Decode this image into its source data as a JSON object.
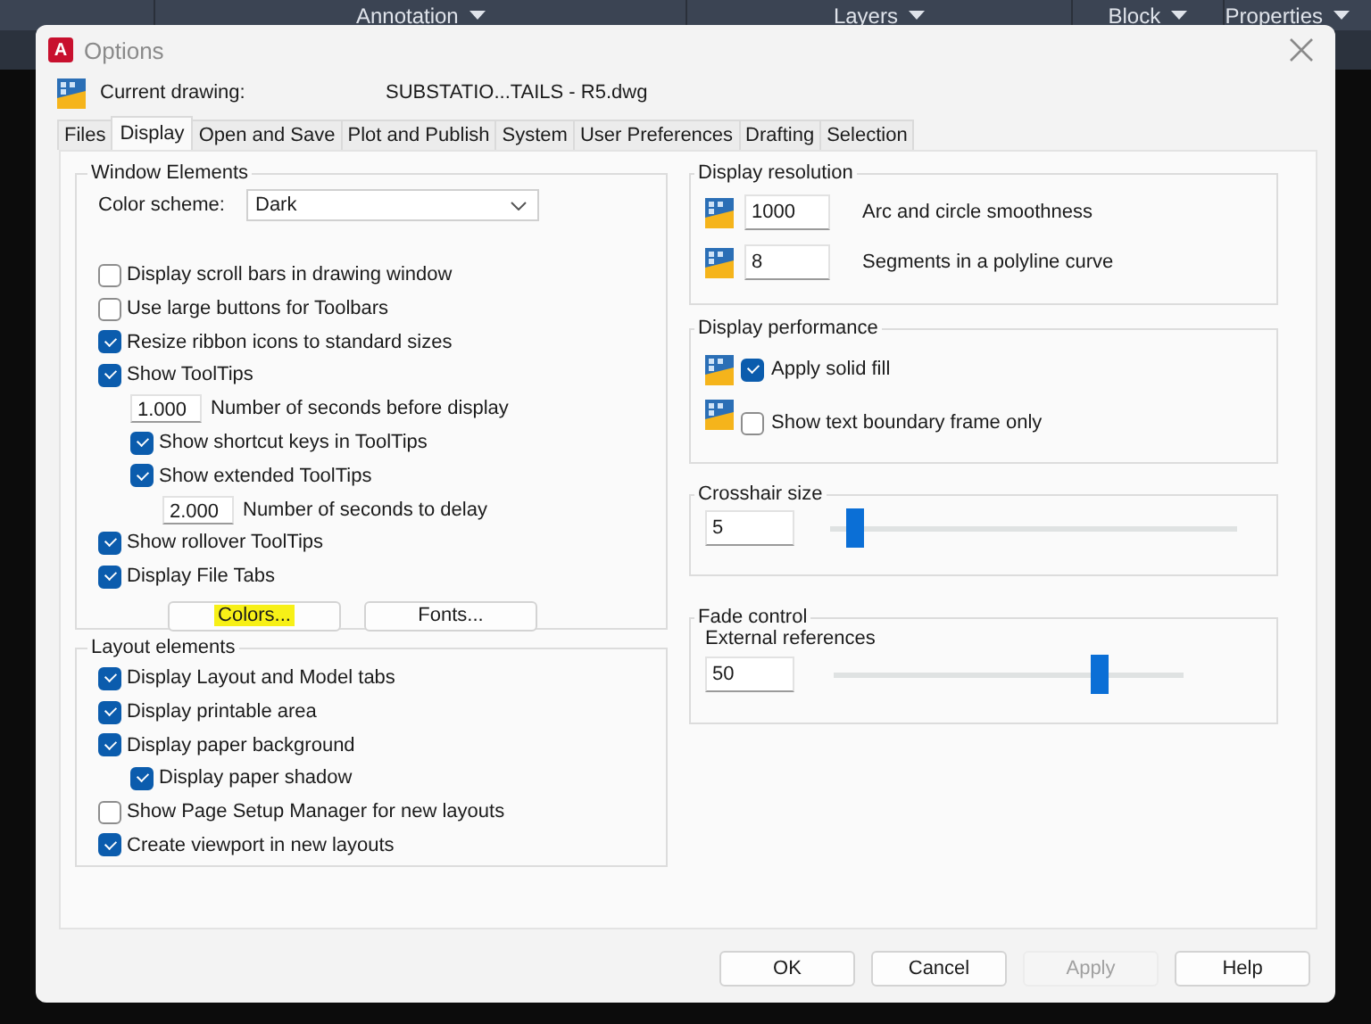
{
  "ribbon": {
    "panels": [
      {
        "label": "Annotation"
      },
      {
        "label": "Layers"
      },
      {
        "label": "Block"
      },
      {
        "label": "Properties"
      }
    ]
  },
  "window": {
    "app_icon": "A",
    "title": "Options"
  },
  "current_drawing": {
    "label": "Current drawing:",
    "value": "SUBSTATIO...TAILS - R5.dwg"
  },
  "tabs": [
    {
      "label": "Files",
      "selected": false
    },
    {
      "label": "Display",
      "selected": true
    },
    {
      "label": "Open and Save",
      "selected": false
    },
    {
      "label": "Plot and Publish",
      "selected": false
    },
    {
      "label": "System",
      "selected": false
    },
    {
      "label": "User Preferences",
      "selected": false
    },
    {
      "label": "Drafting",
      "selected": false
    },
    {
      "label": "Selection",
      "selected": false
    }
  ],
  "window_elements": {
    "title": "Window Elements",
    "color_scheme": {
      "label": "Color scheme:",
      "value": "Dark"
    },
    "items": [
      {
        "kind": "checkbox",
        "label": "Display scroll bars in drawing window",
        "checked": false
      },
      {
        "kind": "checkbox",
        "label": "Use large buttons for Toolbars",
        "checked": false
      },
      {
        "kind": "checkbox",
        "label": "Resize ribbon icons to standard sizes",
        "checked": true
      },
      {
        "kind": "checkbox",
        "label": "Show ToolTips",
        "checked": true,
        "children": [
          {
            "kind": "number",
            "value": "1.000",
            "label": "Number of seconds before display"
          },
          {
            "kind": "checkbox",
            "label": "Show shortcut keys in ToolTips",
            "checked": true
          },
          {
            "kind": "checkbox",
            "label": "Show extended ToolTips",
            "checked": true,
            "children": [
              {
                "kind": "number",
                "value": "2.000",
                "label": "Number of seconds to delay"
              }
            ]
          }
        ]
      },
      {
        "kind": "checkbox",
        "label": "Show rollover ToolTips",
        "checked": true
      },
      {
        "kind": "checkbox",
        "label": "Display File Tabs",
        "checked": true
      }
    ],
    "buttons": [
      {
        "label": "Colors...",
        "highlighted": true
      },
      {
        "label": "Fonts...",
        "highlighted": false
      }
    ]
  },
  "layout_elements": {
    "title": "Layout elements",
    "items": [
      {
        "kind": "checkbox",
        "label": "Display Layout and Model tabs",
        "checked": true
      },
      {
        "kind": "checkbox",
        "label": "Display printable area",
        "checked": true
      },
      {
        "kind": "checkbox",
        "label": "Display paper background",
        "checked": true,
        "children": [
          {
            "kind": "checkbox",
            "label": "Display paper shadow",
            "checked": true
          }
        ]
      },
      {
        "kind": "checkbox",
        "label": "Show Page Setup Manager for new layouts",
        "checked": false
      },
      {
        "kind": "checkbox",
        "label": "Create viewport in new layouts",
        "checked": true
      }
    ]
  },
  "display_resolution": {
    "title": "Display resolution",
    "items": [
      {
        "value": "1000",
        "label": "Arc and circle smoothness"
      },
      {
        "value": "8",
        "label": "Segments in a polyline curve"
      }
    ]
  },
  "display_performance": {
    "title": "Display performance",
    "items": [
      {
        "label": "Apply solid fill",
        "checked": true
      },
      {
        "label": "Show text boundary frame only",
        "checked": false
      }
    ]
  },
  "crosshair_size": {
    "title": "Crosshair size",
    "value": "5",
    "level": 0.06
  },
  "fade_control": {
    "title": "Fade control",
    "label": "External references",
    "value": "50",
    "level": 0.76
  },
  "buttons": [
    {
      "label": "OK",
      "disabled": false
    },
    {
      "label": "Cancel",
      "disabled": false
    },
    {
      "label": "Apply",
      "disabled": true
    },
    {
      "label": "Help",
      "disabled": false
    }
  ]
}
